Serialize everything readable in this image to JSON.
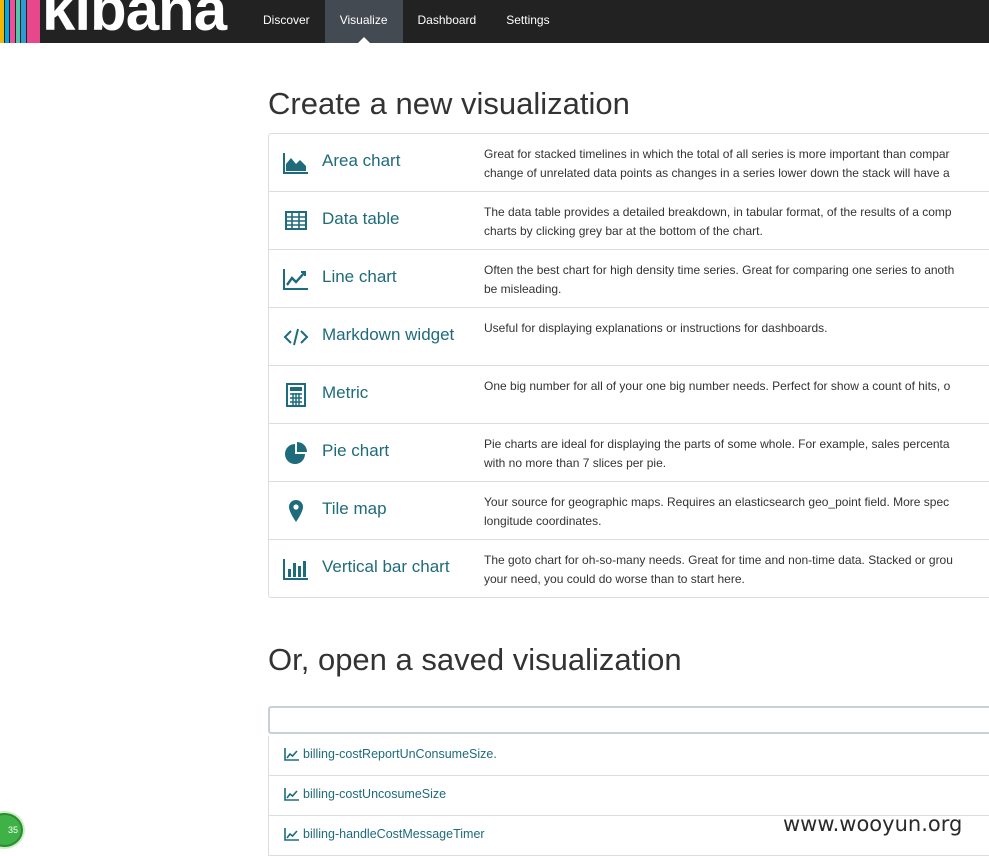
{
  "app": {
    "logo_text": "kibana",
    "nav": [
      {
        "label": "Discover",
        "active": false
      },
      {
        "label": "Visualize",
        "active": true
      },
      {
        "label": "Dashboard",
        "active": false
      },
      {
        "label": "Settings",
        "active": false
      }
    ]
  },
  "create": {
    "heading": "Create a new visualization",
    "types": [
      {
        "icon": "area-chart-icon",
        "title": "Area chart",
        "description": "Great for stacked timelines in which the total of all series is more important than compar\nchange of unrelated data points as changes in a series lower down the stack will have a"
      },
      {
        "icon": "table-icon",
        "title": "Data table",
        "description": "The data table provides a detailed breakdown, in tabular format, of the results of a comp\ncharts by clicking grey bar at the bottom of the chart."
      },
      {
        "icon": "line-chart-icon",
        "title": "Line chart",
        "description": "Often the best chart for high density time series. Great for comparing one series to anoth\nbe misleading."
      },
      {
        "icon": "code-icon",
        "title": "Markdown widget",
        "description": "Useful for displaying explanations or instructions for dashboards."
      },
      {
        "icon": "calculator-icon",
        "title": "Metric",
        "description": "One big number for all of your one big number needs. Perfect for show a count of hits, o"
      },
      {
        "icon": "pie-chart-icon",
        "title": "Pie chart",
        "description": "Pie charts are ideal for displaying the parts of some whole. For example, sales percenta\nwith no more than 7 slices per pie."
      },
      {
        "icon": "map-marker-icon",
        "title": "Tile map",
        "description": "Your source for geographic maps. Requires an elasticsearch geo_point field. More spec\nlongitude coordinates."
      },
      {
        "icon": "bar-chart-icon",
        "title": "Vertical bar chart",
        "description": "The goto chart for oh-so-many needs. Great for time and non-time data. Stacked or grou\nyour need, you could do worse than to start here."
      }
    ]
  },
  "saved": {
    "heading": "Or, open a saved visualization",
    "search_value": "",
    "items": [
      {
        "icon": "line-chart-icon",
        "label": "billing-costReportUnConsumeSize."
      },
      {
        "icon": "line-chart-icon",
        "label": "billing-costUncosumeSize"
      },
      {
        "icon": "line-chart-icon",
        "label": "billing-handleCostMessageTimer"
      }
    ]
  },
  "overlay": {
    "watermark": "www.wooyun.org",
    "badge_text": "35"
  },
  "colors": {
    "navbar": "#222222",
    "nav_active": "#444a51",
    "link": "#1e6b7b",
    "border": "#dddddd"
  }
}
